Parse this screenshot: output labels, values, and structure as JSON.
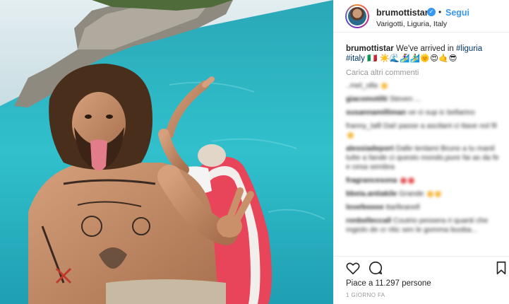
{
  "header": {
    "username": "brumottistar",
    "verified_mark": "✓",
    "separator": "•",
    "follow_label": "Segui",
    "location": "Varigotti, Liguria, Italy"
  },
  "caption": {
    "username": "brumottistar",
    "text": "We've arrived in ",
    "hashtag1": "#liguria",
    "hashtag2": "#italy",
    "trailing": "🇮🇹 ☀️🌊🏄‍♀️🏄‍♂️🌞😍🤙😎"
  },
  "load_more": "Carica altri commenti",
  "blurred_comments": [
    {
      "user": "",
      "text": "..mel_olla"
    },
    {
      "user": "giacomotilti",
      "text": "Steven ..."
    },
    {
      "user": "susannamilliman",
      "text": "ve ci sup ic bellarino"
    },
    {
      "user": "",
      "text": "franny_lalll Dai! passe a ascilant ci ttave nol fil"
    },
    {
      "user": "alessiadeport",
      "text": "Dalle tenlami Bruno a tu manil tutte a fande ci questo mondo,pure fai as da fe e cesa sembra"
    },
    {
      "user": "fragrancesona",
      "text": ""
    },
    {
      "user": "bbeia.antiakile",
      "text": "Grande"
    },
    {
      "user": "lovefeeeee",
      "text": "ttarlleanell"
    },
    {
      "user": "ronbelleccall",
      "text": "Coutrio pessera ri quanti che mgiolo de cr ritic sen le gomma buoba..."
    }
  ],
  "actions": {
    "likes": "Piace a 11.297 persone",
    "time": "1 GIORNO FA"
  },
  "icons": [
    "heart-icon",
    "comment-icon",
    "bookmark-icon",
    "verified-icon"
  ],
  "colors": {
    "accent": "#3897f0",
    "sea": "#2fb4c4",
    "board": "#e8445a"
  }
}
